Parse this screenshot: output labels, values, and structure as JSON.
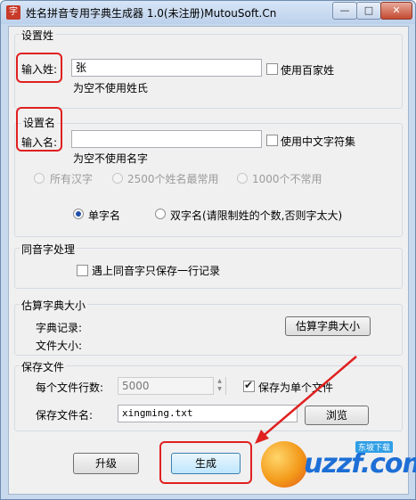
{
  "window": {
    "title": "姓名拼音专用字典生成器 1.0(未注册)MutouSoft.Cn",
    "app_icon_glyph": "字",
    "controls": {
      "minimize": "—",
      "maximize": "□",
      "close": "✕"
    }
  },
  "surname_group": {
    "title": "设置姓",
    "input_label": "输入姓:",
    "input_value": "张",
    "hint": "为空不使用姓氏",
    "checkbox_label": "使用百家姓",
    "checkbox_checked": false
  },
  "name_group": {
    "title": "设置名",
    "input_label": "输入名:",
    "input_value": "",
    "hint": "为空不使用名字",
    "checkbox_label": "使用中文字符集",
    "checkbox_checked": false,
    "charset_options": [
      "所有汉字",
      "2500个姓名最常用",
      "1000个不常用"
    ],
    "length_options": [
      "单字名",
      "双字名(请限制姓的个数,否则字太大)"
    ],
    "selected_length": "单字名"
  },
  "homophone_group": {
    "title": "同音字处理",
    "checkbox_label": "遇上同音字只保存一行记录",
    "checkbox_checked": false
  },
  "estimate_group": {
    "title": "估算字典大小",
    "records_label": "字典记录:",
    "size_label": "文件大小:",
    "button_label": "估算字典大小"
  },
  "save_group": {
    "title": "保存文件",
    "lines_label": "每个文件行数:",
    "lines_value": "5000",
    "single_file_label": "保存为单个文件",
    "single_file_checked": true,
    "filename_label": "保存文件名:",
    "filename_value": "xingming.txt",
    "browse_label": "浏览"
  },
  "footer": {
    "upgrade_label": "升级",
    "generate_label": "生成"
  },
  "watermark": {
    "text": "uzzf.com",
    "badge": "东坡下载"
  },
  "colors": {
    "annotation_red": "#e02020",
    "titlebar": "#c8d9ee",
    "close_button": "#c44a32",
    "radio_selected": "#1f4fa8"
  }
}
